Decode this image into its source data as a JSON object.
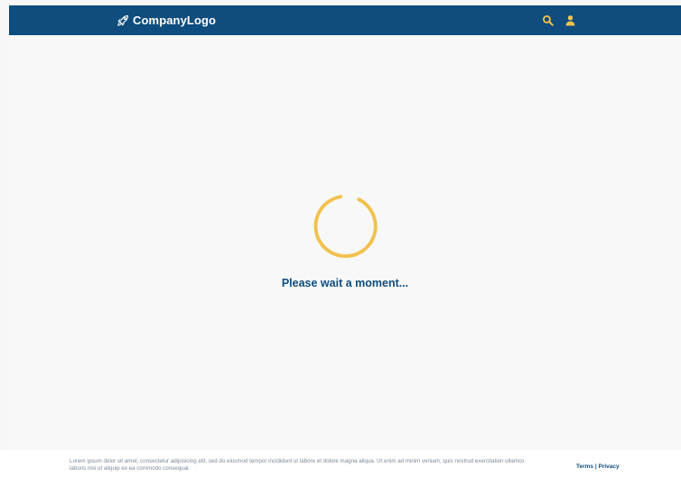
{
  "header": {
    "logo_text": "CompanyLogo",
    "logo_icon": "rocket-icon",
    "icons": [
      "search-icon",
      "user-icon"
    ]
  },
  "main": {
    "loading_text": "Please wait a moment..."
  },
  "footer": {
    "text": "Lorem ipsum dolor sit amet, consectetur adipisicing elit, sed do eiusmod tempor incididunt ut labore et dolore magna aliqua. Ut enim ad minim veniam, quis nostrud exercitation ullamco laboris nisi ut aliquip ex ea commodo consequat.",
    "terms_label": "Terms",
    "separator": "|",
    "privacy_label": "Privacy"
  },
  "colors": {
    "header_bg": "#0e4d7d",
    "accent": "#f2c14e",
    "page_bg": "#f8f8f8",
    "text_primary": "#0e4d7d"
  }
}
